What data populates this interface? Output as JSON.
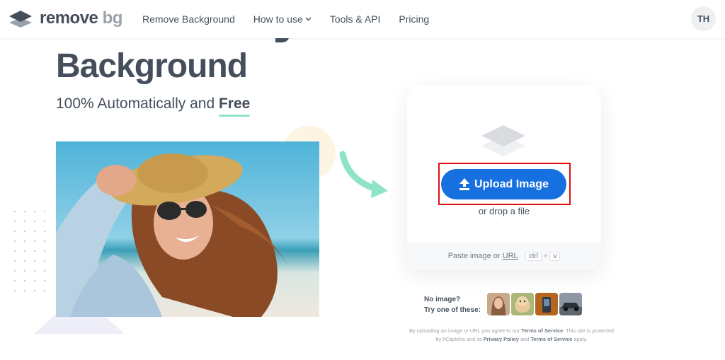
{
  "header": {
    "logo_main": "remove",
    "logo_sub": "bg",
    "nav": [
      {
        "label": "Remove Background"
      },
      {
        "label": "How to use"
      },
      {
        "label": "Tools & API"
      },
      {
        "label": "Pricing"
      }
    ],
    "avatar_initials": "TH"
  },
  "hero": {
    "title": "Background",
    "subtitle_prefix": "100% Automatically and ",
    "subtitle_emph": "Free"
  },
  "upload": {
    "button_label": "Upload Image",
    "drop_text": "or drop a file",
    "paste_prefix": "Paste image or",
    "paste_link": "URL",
    "key_ctrl": "ctrl",
    "key_plus": "+",
    "key_v": "v"
  },
  "samples": {
    "line1": "No image?",
    "line2": "Try one of these:"
  },
  "legal": {
    "p1": "By uploading an image or URL you agree to our",
    "terms1": "Terms of Service",
    "p2": ". This site is protected by hCaptcha and its",
    "privacy": "Privacy Policy",
    "p3": "and",
    "terms2": "Terms of Service",
    "p4": "apply."
  },
  "colors": {
    "primary": "#1770e0",
    "accent_underline": "#8ee3c8",
    "arrow": "#8ee3c8",
    "highlight_box": "#e01111"
  },
  "icons": [
    "logo-stack-icon",
    "chevron-down-icon",
    "layers-icon",
    "upload-arrow-icon",
    "curved-arrow-icon"
  ]
}
